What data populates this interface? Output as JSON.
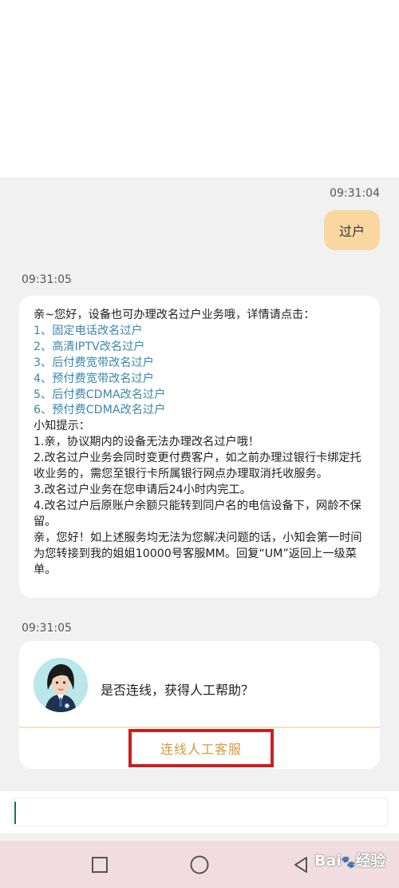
{
  "chat": {
    "user_time": "09:31:04",
    "user_message": "过户",
    "bot_time": "09:31:05",
    "bot_lines": [
      {
        "text": "亲~您好，设备也可办理改名过户业务哦，详情请点击：",
        "type": "text"
      },
      {
        "text": "1、固定电话改名过户",
        "type": "link"
      },
      {
        "text": "2、高清IPTV改名过户",
        "type": "link"
      },
      {
        "text": "3、后付费宽带改名过户",
        "type": "link"
      },
      {
        "text": "4、预付费宽带改名过户",
        "type": "link"
      },
      {
        "text": "5、后付费CDMA改名过户",
        "type": "link"
      },
      {
        "text": "6、预付费CDMA改名过户",
        "type": "link"
      },
      {
        "text": "小知提示：",
        "type": "text"
      },
      {
        "text": "1.亲，协议期内的设备无法办理改名过户哦！",
        "type": "text"
      },
      {
        "text": "2.改名过户业务会同时变更付费客户，如之前办理过银行卡绑定托收业务的，需您至银行卡所属银行网点办理取消托收服务。",
        "type": "wrap"
      },
      {
        "text": "3.改名过户业务在您申请后24小时内完工。",
        "type": "text"
      },
      {
        "text": "4.改名过户后原账户余额只能转到同户名的电信设备下，网龄不保留。",
        "type": "wrap"
      },
      {
        "text": "亲，您好！如上述服务均无法为您解决问题的话，小知会第一时间为您转接到我的姐姐10000号客服MM。回复“UM”返回上一级菜单。",
        "type": "wrap"
      }
    ],
    "card_time": "09:31:05",
    "card_question": "是否连线，获得人工帮助？",
    "connect_label": "连线人工客服"
  },
  "input": {
    "value": "",
    "placeholder": ""
  },
  "nav": {
    "icons": [
      "square-icon",
      "circle-icon",
      "triangle-back-icon"
    ]
  },
  "watermark": {
    "text": "Bai",
    "text2": "经验"
  },
  "colors": {
    "user_bubble": "#f9d7a1",
    "link": "#3b87a8",
    "connect_text": "#d39b3a",
    "highlight_box": "#c8201f",
    "navbar": "#f1dde1"
  }
}
